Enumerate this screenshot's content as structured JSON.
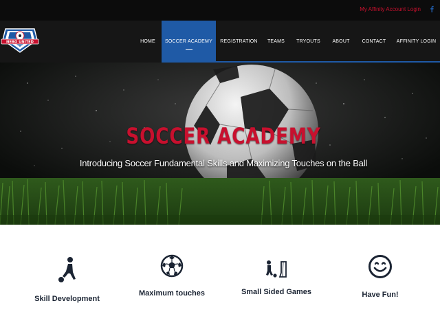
{
  "topbar": {
    "login_label": "My Affinity Account Login",
    "social_icon": "facebook-icon"
  },
  "logo": {
    "alt": "Nebo United Soccer Club logo",
    "text": "NEBO UNITED",
    "colors": {
      "blue": "#1f5aa6",
      "red": "#c8102e"
    }
  },
  "nav": {
    "items": [
      {
        "label": "HOME",
        "active": false
      },
      {
        "label": "SOCCER ACADEMY",
        "active": true
      },
      {
        "label": "REGISTRATION",
        "active": false
      },
      {
        "label": "TEAMS",
        "active": false
      },
      {
        "label": "TRYOUTS",
        "active": false
      },
      {
        "label": "ABOUT",
        "active": false
      },
      {
        "label": "CONTACT",
        "active": false
      },
      {
        "label": "AFFINITY LOGIN",
        "active": false
      }
    ]
  },
  "hero": {
    "title": "SOCCER ACADEMY",
    "subtitle": "Introducing Soccer Fundamental Skills and Maximizing Touches on the Ball"
  },
  "features": [
    {
      "label": "Skill Development",
      "icon": "player-kicking-icon"
    },
    {
      "label": "Maximum touches",
      "icon": "soccer-ball-icon"
    },
    {
      "label": "Small Sided Games",
      "icon": "small-goal-icon"
    },
    {
      "label": "Have Fun!",
      "icon": "smiley-face-icon"
    }
  ],
  "colors": {
    "accent_blue": "#1f5aa6",
    "brand_red": "#c8102e",
    "text_dark": "#1b2433"
  }
}
